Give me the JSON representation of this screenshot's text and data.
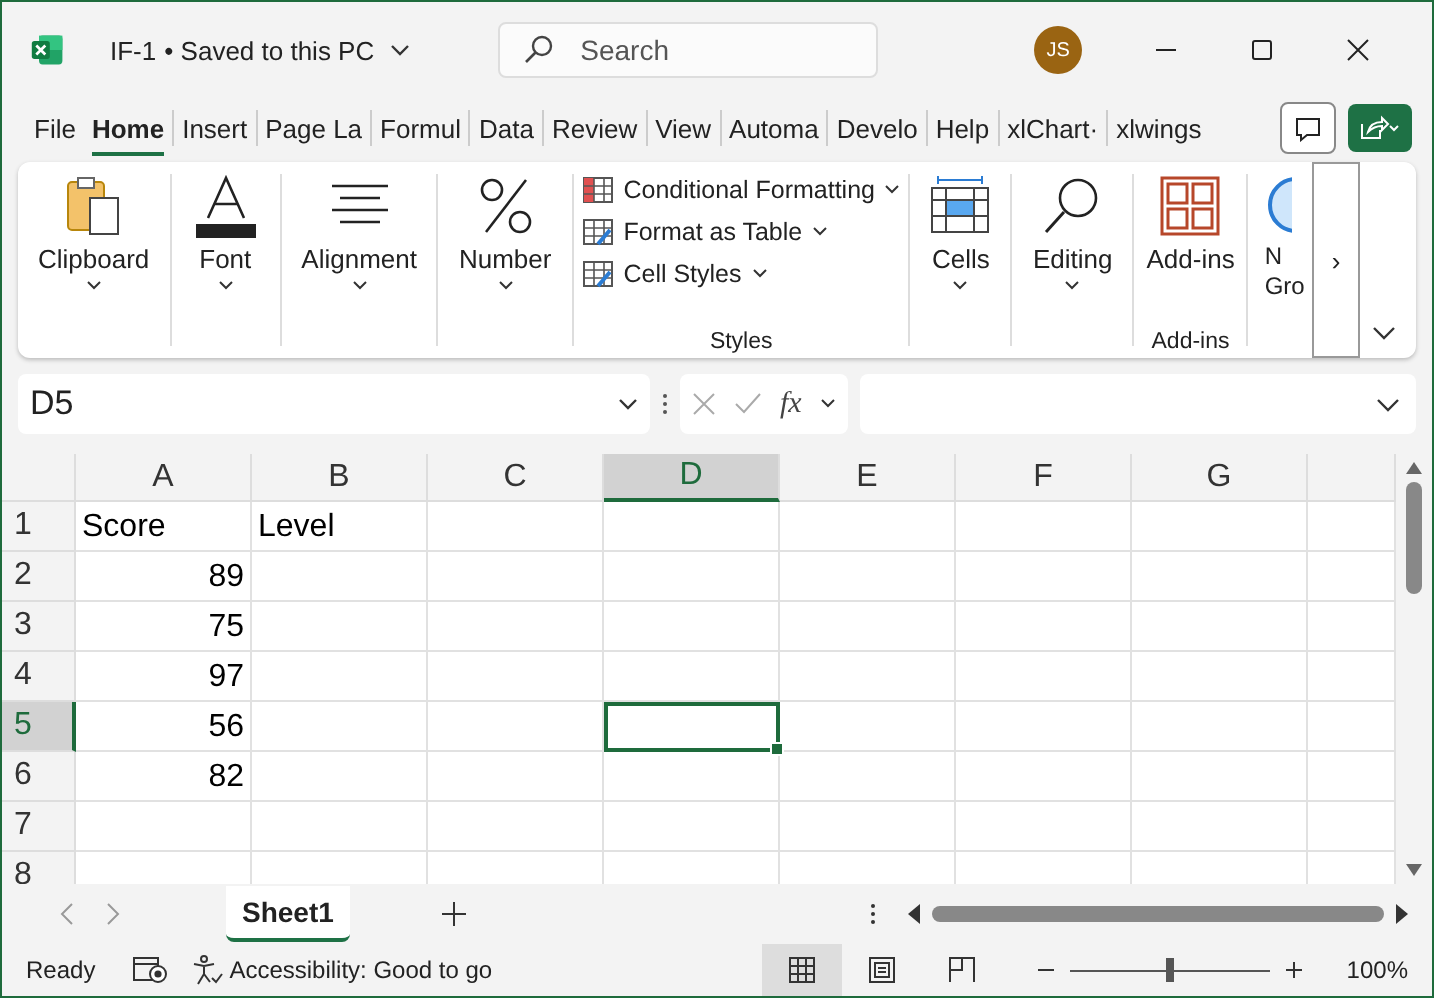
{
  "window": {
    "title": "IF-1",
    "save_status": "• Saved to this PC",
    "user_initials": "JS"
  },
  "search": {
    "placeholder": "Search"
  },
  "tabs": [
    {
      "label": "File",
      "selected": false
    },
    {
      "label": "Home",
      "selected": true
    },
    {
      "label": "Insert",
      "selected": false
    },
    {
      "label": "Page La",
      "selected": false
    },
    {
      "label": "Formul",
      "selected": false
    },
    {
      "label": "Data",
      "selected": false
    },
    {
      "label": "Review",
      "selected": false
    },
    {
      "label": "View",
      "selected": false
    },
    {
      "label": "Automa",
      "selected": false
    },
    {
      "label": "Develo",
      "selected": false
    },
    {
      "label": "Help",
      "selected": false
    },
    {
      "label": "xlChart·",
      "selected": false
    },
    {
      "label": "xlwings",
      "selected": false
    }
  ],
  "ribbon": {
    "groups": [
      {
        "kind": "big",
        "items": [
          {
            "label": "Clipboard"
          }
        ]
      },
      {
        "kind": "big",
        "items": [
          {
            "label": "Font"
          }
        ]
      },
      {
        "kind": "big",
        "items": [
          {
            "label": "Alignment"
          }
        ]
      },
      {
        "kind": "big",
        "items": [
          {
            "label": "Number"
          }
        ]
      },
      {
        "kind": "stack",
        "label": "Styles",
        "items": [
          {
            "label": "Conditional Formatting"
          },
          {
            "label": "Format as Table"
          },
          {
            "label": "Cell Styles"
          }
        ]
      },
      {
        "kind": "big",
        "items": [
          {
            "label": "Cells"
          }
        ]
      },
      {
        "kind": "big",
        "items": [
          {
            "label": "Editing"
          }
        ]
      },
      {
        "kind": "addin",
        "label": "Add-ins",
        "items": [
          {
            "label": "Add-ins"
          }
        ]
      },
      {
        "kind": "cut",
        "items": [
          {
            "label": "N Gro"
          }
        ]
      }
    ],
    "scroll_button": "›"
  },
  "formula_bar": {
    "name_box": "D5",
    "fx": "fx"
  },
  "sheet": {
    "columns": [
      {
        "label": "A",
        "selected": false
      },
      {
        "label": "B",
        "selected": false
      },
      {
        "label": "C",
        "selected": false
      },
      {
        "label": "D",
        "selected": true
      },
      {
        "label": "E",
        "selected": false
      },
      {
        "label": "F",
        "selected": false
      },
      {
        "label": "G",
        "selected": false
      }
    ],
    "rows": [
      {
        "label": "1",
        "selected": false,
        "cells": [
          {
            "text": "Score",
            "kind": "text"
          },
          {
            "text": "Level",
            "kind": "text"
          }
        ]
      },
      {
        "label": "2",
        "selected": false,
        "cells": [
          {
            "text": "89",
            "kind": "number"
          }
        ]
      },
      {
        "label": "3",
        "selected": false,
        "cells": [
          {
            "text": "75",
            "kind": "number"
          }
        ]
      },
      {
        "label": "4",
        "selected": false,
        "cells": [
          {
            "text": "97",
            "kind": "number"
          }
        ]
      },
      {
        "label": "5",
        "selected": true,
        "cells": [
          {
            "text": "56",
            "kind": "number"
          }
        ]
      },
      {
        "label": "6",
        "selected": false,
        "cells": [
          {
            "text": "82",
            "kind": "number"
          }
        ]
      },
      {
        "label": "7",
        "selected": false,
        "cells": []
      },
      {
        "label": "8",
        "selected": false,
        "cells": []
      }
    ]
  },
  "sheet_tabs": [
    {
      "label": "Sheet1",
      "selected": true
    }
  ],
  "status_bar": {
    "status": "Ready",
    "accessibility": "Accessibility: Good to go",
    "views": [
      {
        "selected": true
      },
      {
        "selected": false
      },
      {
        "selected": false
      }
    ],
    "zoom": {
      "level": 0.5,
      "reading": "100%"
    }
  }
}
